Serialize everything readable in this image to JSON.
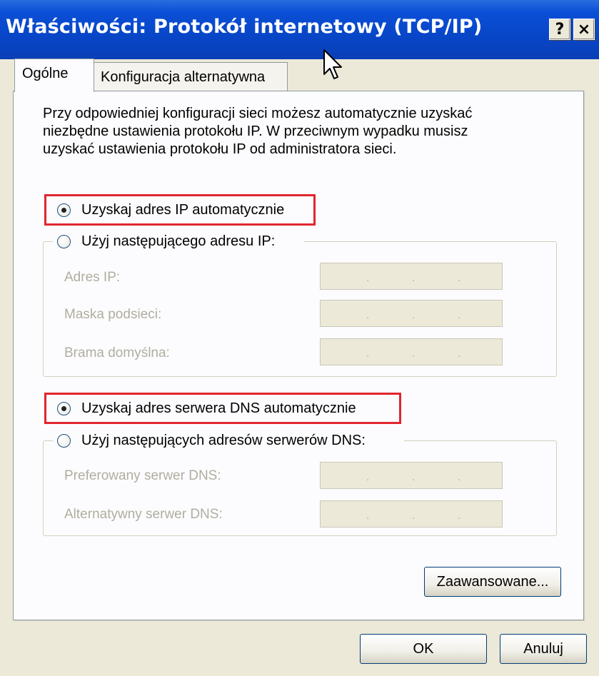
{
  "window": {
    "title": "Właściwości: Protokół internetowy (TCP/IP)",
    "help_label": "?",
    "close_label": "×"
  },
  "tabs": [
    {
      "label": "Ogólne",
      "active": true
    },
    {
      "label": "Konfiguracja alternatywna",
      "active": false
    }
  ],
  "description": {
    "lines": [
      "Przy odpowiedniej konfiguracji sieci możesz automatycznie uzyskać",
      "niezbędne ustawienia protokołu IP. W przeciwnym wypadku musisz",
      "uzyskać ustawienia protokołu IP od administratora sieci."
    ]
  },
  "ip": {
    "auto_label": "Uzyskaj adres IP automatycznie",
    "manual_label": "Użyj następującego adresu IP:",
    "selected": "auto",
    "fields": [
      {
        "label": "Adres IP:",
        "value": ". . ."
      },
      {
        "label": "Maska podsieci:",
        "value": ". . ."
      },
      {
        "label": "Brama domyślna:",
        "value": ". . ."
      }
    ]
  },
  "dns": {
    "auto_label": "Uzyskaj adres serwera DNS automatycznie",
    "manual_label": "Użyj następujących adresów serwerów DNS:",
    "selected": "auto",
    "fields": [
      {
        "label": "Preferowany serwer DNS:",
        "value": ". . ."
      },
      {
        "label": "Alternatywny serwer DNS:",
        "value": ". . ."
      }
    ]
  },
  "buttons": {
    "advanced": "Zaawansowane...",
    "ok": "OK",
    "cancel": "Anuluj"
  },
  "colors": {
    "titlebar": "#0a4fd6",
    "highlight_box": "#e0262e",
    "dialog_bg": "#ece9d8"
  }
}
